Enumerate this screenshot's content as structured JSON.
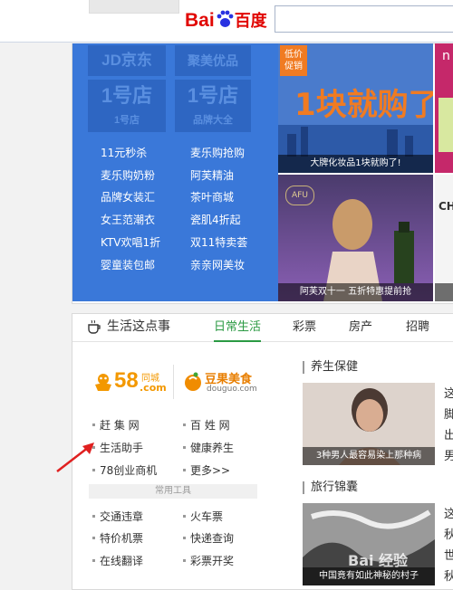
{
  "header": {
    "top_tab_label": "",
    "logo_bai": "Bai",
    "logo_du": "du",
    "logo_cn": "百度"
  },
  "promo": {
    "logo_tiles": [
      "JD京东",
      "聚美优品",
      "1号店",
      "1号店"
    ],
    "logo_tile_subs": [
      "1号店",
      "品牌大全"
    ],
    "links_left": [
      "11元秒杀",
      "麦乐购奶粉",
      "品牌女装汇",
      "女王范潮衣",
      "KTV欢唱1折",
      "婴童装包邮"
    ],
    "links_right": [
      "麦乐购抢购",
      "阿芙精油",
      "茶叶商城",
      "瓷肌4折起",
      "双11特卖荟",
      "亲亲网美妆"
    ],
    "ad1": {
      "badge": "低价\n促销",
      "headline": "1块就购了",
      "caption": "大牌化妆品1块就购了!"
    },
    "ad2": {
      "brand": "AFU",
      "caption": "阿芙双十一 五折特惠提前抢"
    },
    "ad3": {
      "label": "n"
    },
    "ad4": {
      "label": "CH"
    }
  },
  "life": {
    "title": "生活这点事",
    "tabs": [
      "日常生活",
      "彩票",
      "房产",
      "招聘"
    ],
    "logo_58_big": "58",
    "logo_58_small_top": "同城",
    "logo_58_small_bottom": ".com",
    "logo_douguo_top": "豆果美食",
    "logo_douguo_bottom": "douguo.com",
    "links_group1_left": [
      "赶 集 网",
      "生活助手",
      "78创业商机"
    ],
    "links_group1_right": [
      "百 姓 网",
      "健康养生",
      "更多>>"
    ],
    "common_tools_label": "常用工具",
    "links_group2_left": [
      "交通违章",
      "特价机票",
      "在线翻译"
    ],
    "links_group2_right": [
      "火车票",
      "快递查询",
      "彩票开奖"
    ],
    "health_title": "养生保健",
    "health_caption": "3种男人最容易染上那种病",
    "health_side_text": [
      "这",
      "脚",
      "出",
      "男"
    ],
    "travel_title": "旅行锦囊",
    "travel_caption": "中国竟有如此神秘的村子",
    "travel_side_text": [
      "这",
      "秋",
      "世",
      "秋"
    ],
    "watermark": "Bai 经验"
  },
  "colors": {
    "accent_blue": "#3a78d9",
    "baidu_red": "#e10602",
    "baidu_blue": "#2932e1",
    "tab_green": "#2b9a43",
    "arrow_red": "#e02020"
  }
}
